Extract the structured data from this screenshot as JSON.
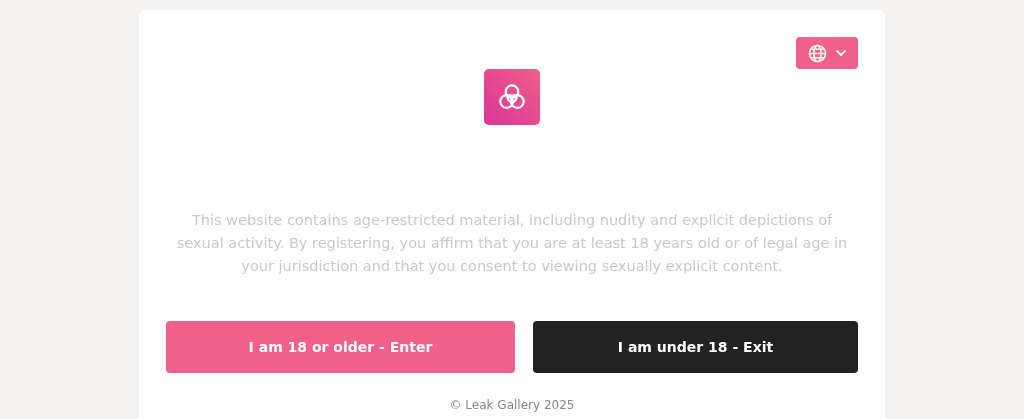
{
  "language_button": {
    "expanded": false
  },
  "notice": "This website contains age-restricted material, including nudity and explicit depictions of sexual activity. By registering, you affirm that you are at least 18 years old or of legal age in your jurisdiction and that you consent to viewing sexually explicit content.",
  "buttons": [
    {
      "label": "I am 18 or older - Enter",
      "kind": "primary"
    },
    {
      "label": "I am under 18 - Exit",
      "kind": "dark"
    }
  ],
  "footer": "© Leak Gallery 2025"
}
